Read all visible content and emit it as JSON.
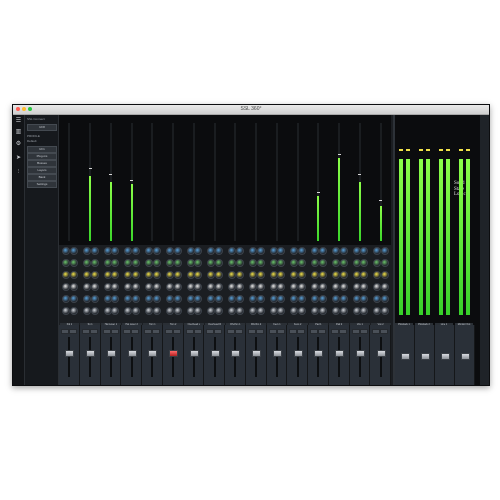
{
  "window": {
    "title": "SSL 360°"
  },
  "brand": {
    "line1": "Solid",
    "line2": "State",
    "line3": "Logic"
  },
  "colors": {
    "meter_green": "#3bd62a",
    "peak_yellow": "#f2e24a",
    "mute_red": "#d23b3b",
    "panel": "#2a3038"
  },
  "sidebar": {
    "icons": [
      "menu-icon",
      "mixer-icon",
      "gear-icon",
      "send-icon",
      "fader-icon"
    ]
  },
  "side_panel": {
    "title": "SSL Connect",
    "buttons": [
      "UF8",
      "UF1",
      "Plug-ins",
      "Busses",
      "Layers",
      "Bank",
      "Settings"
    ],
    "label_profile": "PROFILE",
    "label_default": "Default"
  },
  "mixer": {
    "channels": [
      {
        "name": "Kik 1",
        "level": 0.0,
        "peak": 0.0
      },
      {
        "name": "Sn 1",
        "level": 0.55,
        "peak": 0.6
      },
      {
        "name": "Hat Layer 1",
        "level": 0.5,
        "peak": 0.55
      },
      {
        "name": "Hat Layer 2",
        "level": 0.48,
        "peak": 0.5
      },
      {
        "name": "Tom 1",
        "level": 0.0,
        "peak": 0.0
      },
      {
        "name": "Tom 2",
        "level": 0.0,
        "peak": 0.0
      },
      {
        "name": "Overhead L",
        "level": 0.0,
        "peak": 0.0
      },
      {
        "name": "Overhead R",
        "level": 0.0,
        "peak": 0.0
      },
      {
        "name": "Rhythm 1",
        "level": 0.0,
        "peak": 0.0
      },
      {
        "name": "Rhythm 2",
        "level": 0.0,
        "peak": 0.0
      },
      {
        "name": "Keys 1",
        "level": 0.0,
        "peak": 0.0
      },
      {
        "name": "Keys 2",
        "level": 0.0,
        "peak": 0.0
      },
      {
        "name": "Pad 1",
        "level": 0.38,
        "peak": 0.4
      },
      {
        "name": "Pad 2",
        "level": 0.7,
        "peak": 0.72
      },
      {
        "name": "Vox 1",
        "level": 0.5,
        "peak": 0.55
      },
      {
        "name": "Vox 2",
        "level": 0.3,
        "peak": 0.33
      }
    ],
    "busses": [
      {
        "name": "Playback 1",
        "level": 0.82,
        "peak": 0.86
      },
      {
        "name": "Playback 2",
        "level": 0.82,
        "peak": 0.86
      },
      {
        "name": "Line 1",
        "level": 0.82,
        "peak": 0.86
      },
      {
        "name": "Monitor Out",
        "level": 0.82,
        "peak": 0.86
      }
    ]
  }
}
